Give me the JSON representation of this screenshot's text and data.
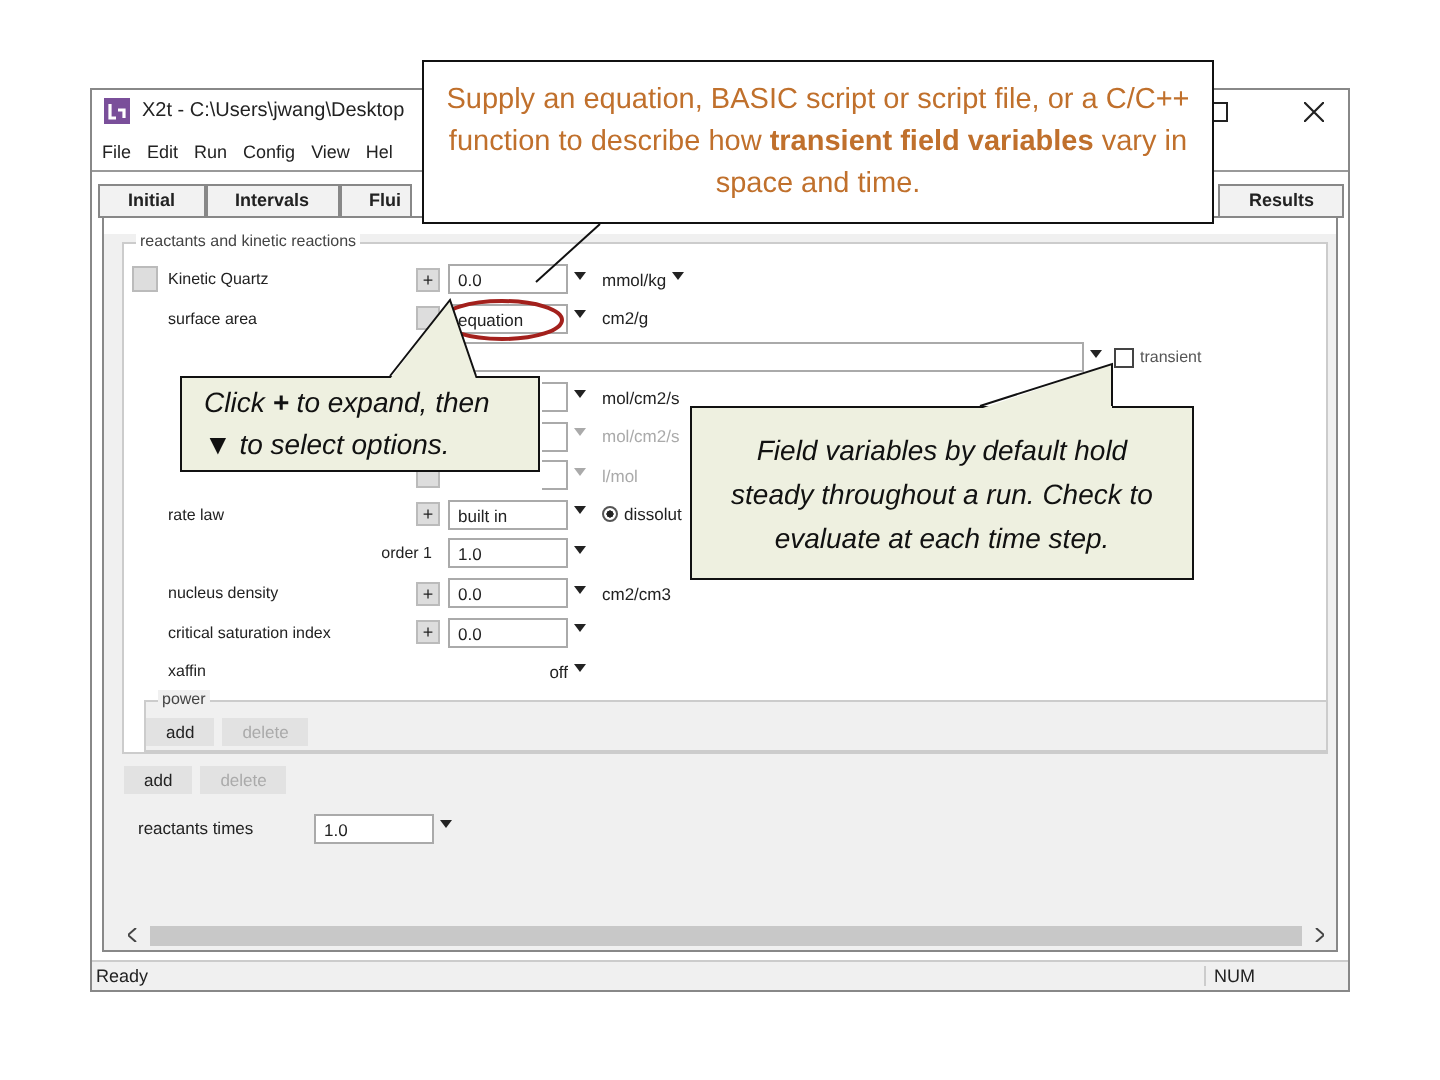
{
  "window": {
    "title": "X2t - C:\\Users\\jwang\\Desktop",
    "controls": [
      {
        "kind": "maximize"
      },
      {
        "kind": "close"
      }
    ]
  },
  "menu": [
    "File",
    "Edit",
    "Run",
    "Config",
    "View",
    "Hel"
  ],
  "tabs": [
    {
      "label": "Initial",
      "selected": false
    },
    {
      "label": "Intervals",
      "selected": false
    },
    {
      "label": "Flui",
      "selected": false
    },
    {
      "label": "Results",
      "selected": false
    }
  ],
  "reactants": {
    "title": "reactants and kinetic reactions",
    "rows": [
      {
        "kind": "reactant",
        "checked": false,
        "label": "Kinetic  Quartz",
        "plus": "+",
        "value": "0.0",
        "unit": "mmol/kg",
        "disabled": false
      },
      {
        "kind": "param",
        "label": "surface area",
        "expander": true,
        "value": "equation",
        "unit": "cm2/g",
        "disabled": false,
        "circled": true
      },
      {
        "kind": "expression",
        "transient": {
          "label": "transient",
          "checked": false
        }
      },
      {
        "kind": "param",
        "unit": "mol/cm2/s",
        "disabled": false
      },
      {
        "kind": "param",
        "unit": "mol/cm2/s",
        "disabled": true
      },
      {
        "kind": "param",
        "expander": true,
        "unit": "l/mol",
        "disabled": true
      },
      {
        "kind": "param",
        "label": "rate law",
        "plus": "+",
        "value": "built in",
        "disabled": false,
        "option": {
          "label": "dissolut",
          "selected": true
        }
      },
      {
        "kind": "order",
        "label": "order 1",
        "value": "1.0",
        "disabled": false
      },
      {
        "kind": "param",
        "label": "nucleus density",
        "plus": "+",
        "value": "0.0",
        "unit": "cm2/cm3",
        "disabled": false
      },
      {
        "kind": "param",
        "label": "critical saturation index",
        "plus": "+",
        "value": "0.0",
        "disabled": false
      },
      {
        "kind": "toggle",
        "label": "xaffin",
        "value": "off",
        "disabled": false
      }
    ],
    "power": {
      "title": "power",
      "buttons": [
        {
          "label": "add",
          "disabled": false
        },
        {
          "label": "delete",
          "disabled": true
        }
      ]
    },
    "buttons": [
      {
        "label": "add",
        "disabled": false
      },
      {
        "label": "delete",
        "disabled": true
      }
    ]
  },
  "reactants_times": {
    "label": "reactants times",
    "value": "1.0"
  },
  "status_bar": {
    "message": "Ready",
    "indicators": [
      "NUM"
    ]
  },
  "callouts": [
    {
      "kind": "note",
      "text": "Supply an equation, BASIC script or script file, or a C/C++ function to describe how **transient field variables** vary in space and time."
    },
    {
      "kind": "bubble",
      "text": "Click **+** to expand, then ▼ to select options."
    },
    {
      "kind": "bubble",
      "text": "Field variables by default hold steady throughout a run. Check to evaluate at each time step."
    }
  ]
}
